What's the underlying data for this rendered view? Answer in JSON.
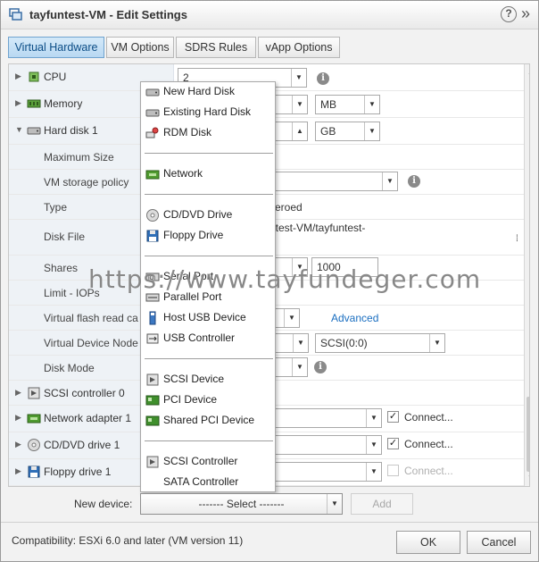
{
  "window": {
    "title": "tayfuntest-VM - Edit Settings",
    "help_label": "?"
  },
  "tabs": [
    {
      "label": "Virtual Hardware"
    },
    {
      "label": "VM Options"
    },
    {
      "label": "SDRS Rules"
    },
    {
      "label": "vApp Options"
    }
  ],
  "hardware": {
    "cpu": {
      "label": "CPU",
      "value": "2"
    },
    "memory": {
      "label": "Memory",
      "unit": "MB"
    },
    "hard_disk": {
      "label": "Hard disk 1",
      "unit": "GB",
      "max_size_label": "Maximum Size",
      "storage_policy_label": "VM storage policy",
      "type_label": "Type",
      "type_value": "zeroed",
      "disk_file_label": "Disk File",
      "disk_file_value": "ntest-VM/tayfuntest-",
      "shares_label": "Shares",
      "shares_value": "1000",
      "limit_label": "Limit - IOPs",
      "vflash_label": "Virtual flash read ca",
      "advanced_link": "Advanced",
      "vdn_label": "Virtual Device Node",
      "vdn_value": "SCSI(0:0)",
      "disk_mode_label": "Disk Mode"
    },
    "scsi_controller": {
      "label": "SCSI controller 0"
    },
    "network_adapter": {
      "label": "Network adapter 1",
      "connect_label": "Connect..."
    },
    "cd_dvd": {
      "label": "CD/DVD drive 1",
      "connect_label": "Connect..."
    },
    "floppy": {
      "label": "Floppy drive 1",
      "connect_label": "Connect..."
    }
  },
  "menu": {
    "items": [
      {
        "label": "New Hard Disk",
        "icon": "hard-disk-icon"
      },
      {
        "label": "Existing Hard Disk",
        "icon": "hard-disk-icon"
      },
      {
        "label": "RDM Disk",
        "icon": "rdm-disk-icon"
      },
      {
        "label": "Network",
        "icon": "network-icon"
      },
      {
        "label": "CD/DVD Drive",
        "icon": "cd-dvd-icon"
      },
      {
        "label": "Floppy Drive",
        "icon": "floppy-icon"
      },
      {
        "label": "Serial Port",
        "icon": "serial-port-icon"
      },
      {
        "label": "Parallel Port",
        "icon": "parallel-port-icon"
      },
      {
        "label": "Host USB Device",
        "icon": "usb-device-icon"
      },
      {
        "label": "USB Controller",
        "icon": "usb-controller-icon"
      },
      {
        "label": "SCSI Device",
        "icon": "scsi-device-icon"
      },
      {
        "label": "PCI Device",
        "icon": "pci-device-icon"
      },
      {
        "label": "Shared PCI Device",
        "icon": "pci-device-icon"
      },
      {
        "label": "SCSI Controller",
        "icon": "scsi-controller-icon"
      },
      {
        "label": "SATA Controller",
        "icon": "none"
      }
    ]
  },
  "watermark": "https://www.tayfundeger.com",
  "new_device": {
    "label": "New device:",
    "select_value": "------- Select -------",
    "add_label": "Add"
  },
  "footer": {
    "compatibility": "Compatibility: ESXi 6.0 and later (VM version 11)",
    "ok_label": "OK",
    "cancel_label": "Cancel"
  },
  "colors": {
    "accent_tab": "#b8d8f2",
    "link": "#1a6ec0",
    "label_column_bg": "#eef2f6"
  }
}
